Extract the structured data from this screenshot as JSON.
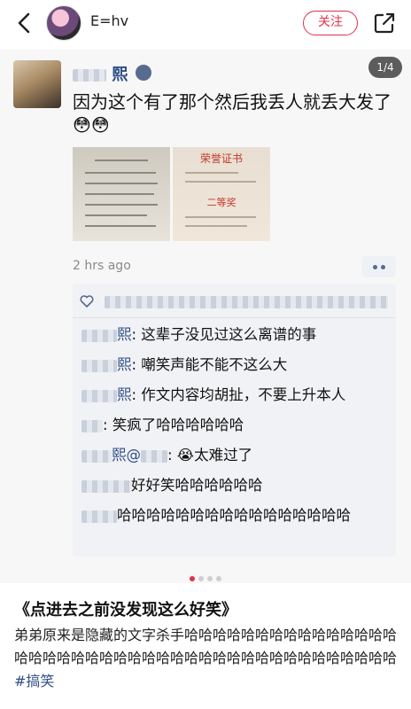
{
  "header": {
    "username": "E=hv",
    "follow_label": "关注",
    "colors": {
      "accent": "#e0314b"
    }
  },
  "photo": {
    "page_indicator": "1/4",
    "post": {
      "author": "熙",
      "text": "因为这个有了那个然后我丢人就丢大发了😳😳",
      "time": "2 hrs ago",
      "thumb_right_title": "荣誉证书",
      "thumb_right_subtitle": "二等奖"
    },
    "comments": [
      {
        "name": "熙",
        "text": ": 这辈子没见过这么离谱的事"
      },
      {
        "name": "熙",
        "text": ": 嘲笑声能不能不这么大"
      },
      {
        "name": "熙",
        "text": ": 作文内容均胡扯，不要上升本人"
      },
      {
        "name": "",
        "text": ": 笑疯了哈哈哈哈哈哈"
      },
      {
        "name": "熙@",
        "text": ": 😭太难过了"
      },
      {
        "name": "",
        "text": "好好笑哈哈哈哈哈哈"
      },
      {
        "name": "",
        "text": "哈哈哈哈哈哈哈哈哈哈哈哈哈哈哈哈"
      }
    ]
  },
  "carousel": {
    "count": 4,
    "active": 0
  },
  "note": {
    "title": "《点进去之前没发现这么好笑》",
    "body": "弟弟原来是隐藏的文字杀手哈哈哈哈哈哈哈哈哈哈哈哈哈哈哈哈哈哈哈哈哈哈哈哈哈哈哈哈哈哈哈哈哈哈哈哈哈哈哈哈哈哈 ",
    "hashtag": "#搞笑"
  }
}
